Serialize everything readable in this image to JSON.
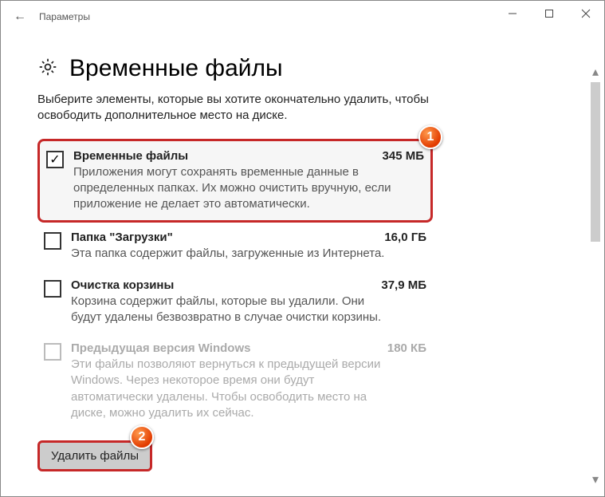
{
  "window": {
    "title": "Параметры"
  },
  "page": {
    "heading": "Временные файлы",
    "subtitle": "Выберите элементы, которые вы хотите окончательно удалить, чтобы освободить дополнительное место на диске."
  },
  "items": [
    {
      "title": "Временные файлы",
      "size": "345 МБ",
      "desc": "Приложения могут сохранять временные данные в определенных папках. Их можно очистить вручную, если приложение не делает это автоматически.",
      "checked": true,
      "disabled": false,
      "highlight": true
    },
    {
      "title": "Папка \"Загрузки\"",
      "size": "16,0 ГБ",
      "desc": "Эта папка содержит файлы, загруженные из Интернета.",
      "checked": false,
      "disabled": false,
      "highlight": false
    },
    {
      "title": "Очистка корзины",
      "size": "37,9 МБ",
      "desc": "Корзина содержит файлы, которые вы удалили. Они будут удалены безвозвратно в случае очистки корзины.",
      "checked": false,
      "disabled": false,
      "highlight": false
    },
    {
      "title": "Предыдущая версия Windows",
      "size": "180 КБ",
      "desc": "Эти файлы позволяют вернуться к предыдущей версии Windows. Через некоторое время они будут автоматически удалены. Чтобы освободить место на диске, можно удалить их сейчас.",
      "checked": false,
      "disabled": true,
      "highlight": false
    }
  ],
  "buttons": {
    "delete": "Удалить файлы"
  },
  "annotations": {
    "badge1": "1",
    "badge2": "2"
  }
}
